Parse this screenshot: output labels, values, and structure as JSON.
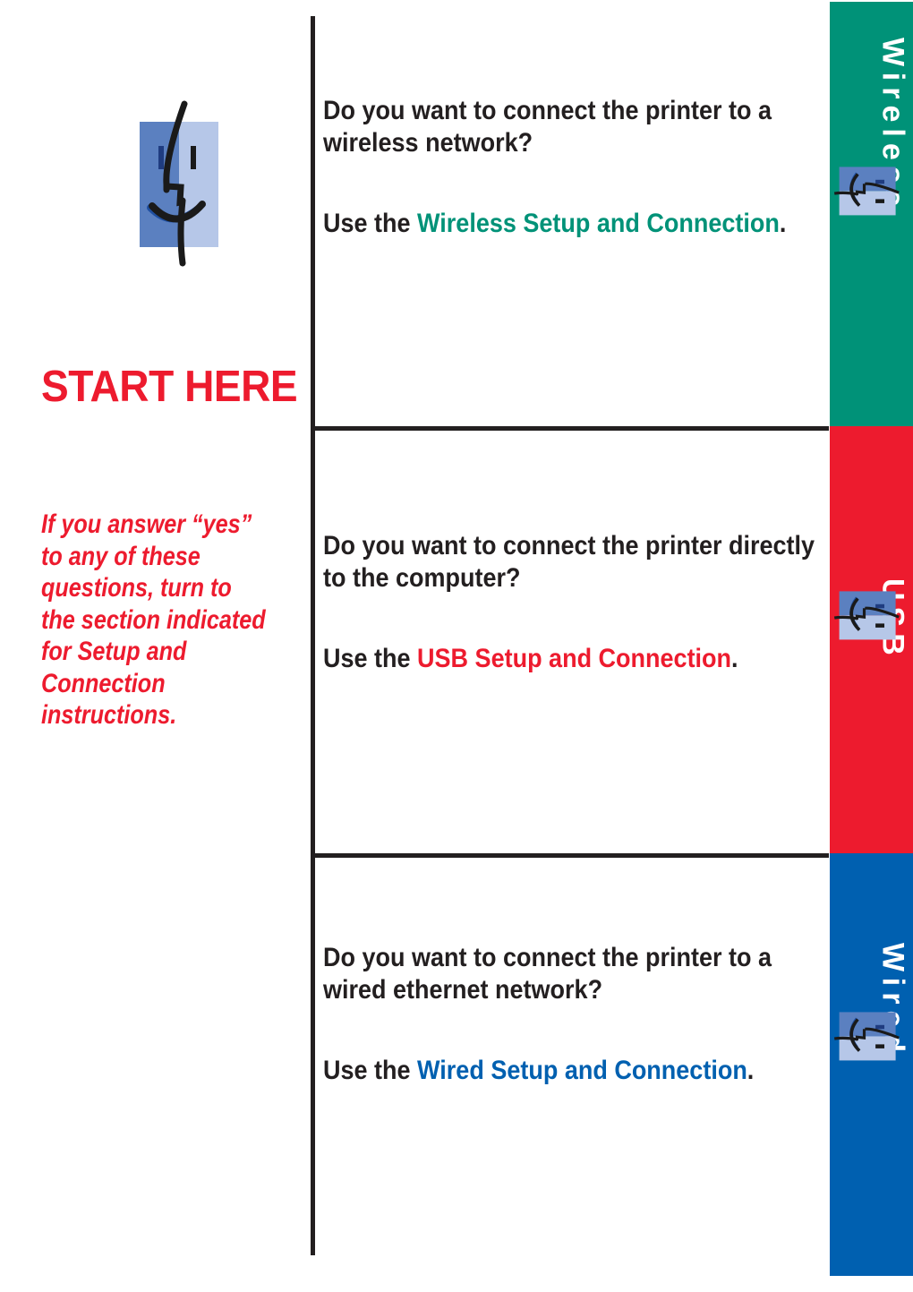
{
  "document": {
    "title": "START HERE",
    "intro_paragraph": "If you answer “yes” to any of these questions, turn to the section indicated for Setup and Connection instructions.",
    "finder_icon_name": "mac-finder-face-icon"
  },
  "colors": {
    "wireless_green": "#009278",
    "usb_red": "#ED1B2E",
    "wired_blue": "#0060B0",
    "rule_black": "#231f20",
    "text_black": "#231f20",
    "icon_dark_blue": "#5B80C0",
    "icon_light_blue": "#B6C7E8",
    "icon_stroke": "#1A1A1A",
    "icon_smile_blue": "#1F4FA0",
    "page_white": "#FFFFFF"
  },
  "rows": [
    {
      "id": "wireless",
      "question": "Do you want to connect the printer to a wireless network?",
      "usage_prefix": "Use the ",
      "usage_accent": "Wireless Setup and Connection",
      "usage_suffix": ".",
      "tab_label": "Wireless",
      "tab_color": "#009278",
      "tab_icon": "mac-finder-face-icon"
    },
    {
      "id": "usb",
      "question": "Do you want to connect the printer directly to the computer?",
      "usage_prefix": "Use the ",
      "usage_accent": "USB Setup and Connection",
      "usage_suffix": ".",
      "tab_label": "USB",
      "tab_color": "#ED1B2E",
      "tab_icon": "mac-finder-face-icon"
    },
    {
      "id": "wired",
      "question": "Do you want to connect the printer to a wired ethernet network?",
      "usage_prefix": "Use the ",
      "usage_accent": "Wired Setup and Connection",
      "usage_suffix": ".",
      "tab_label": "Wired",
      "tab_color": "#0060B0",
      "tab_icon": "mac-finder-face-icon"
    }
  ]
}
